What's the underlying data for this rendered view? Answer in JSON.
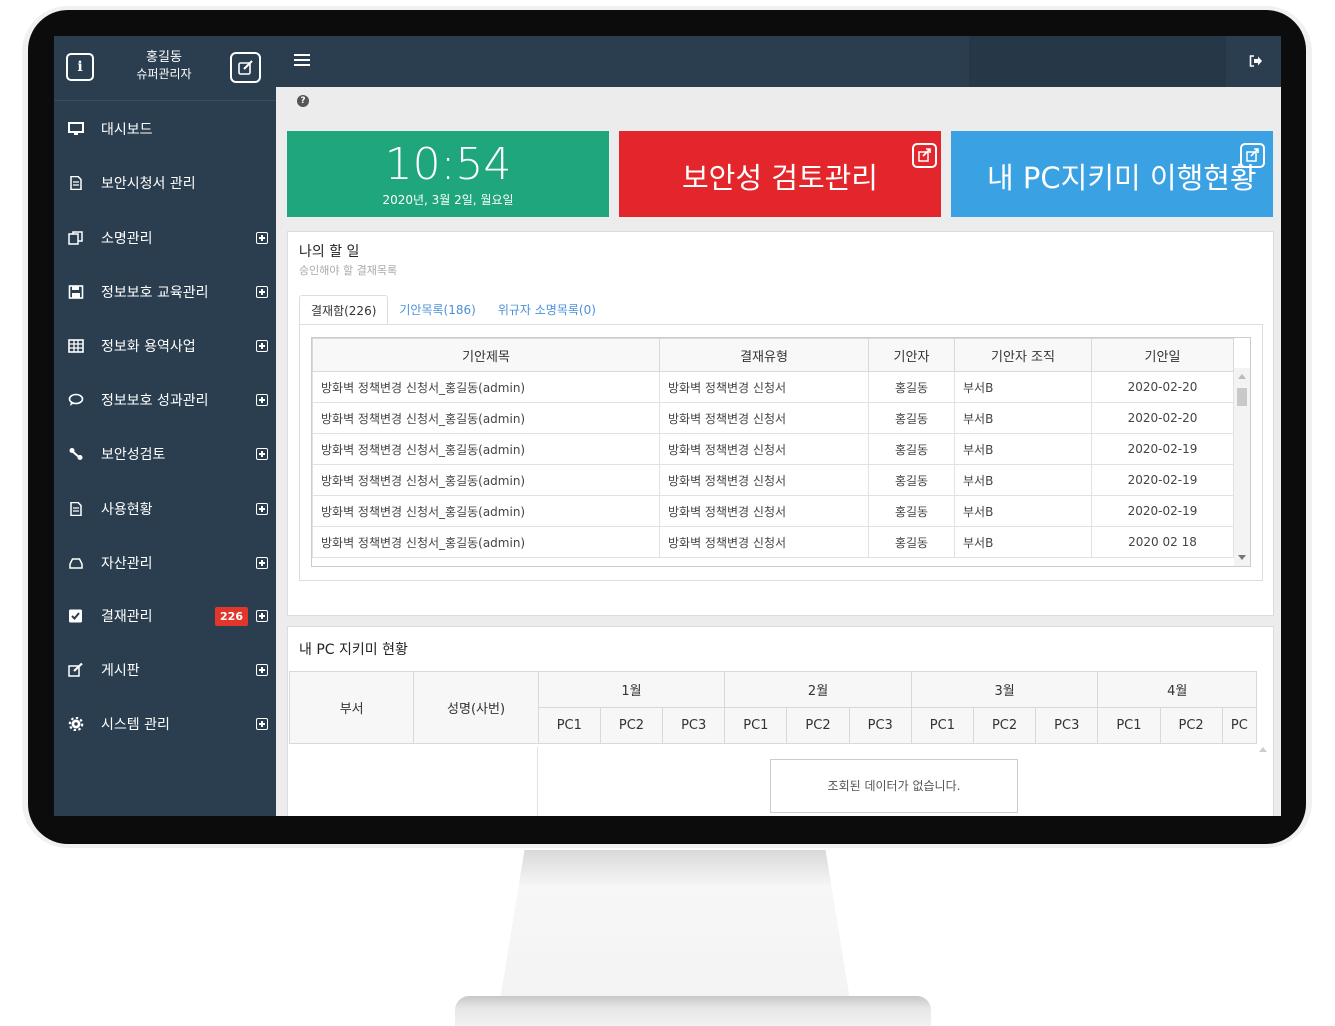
{
  "sidebar": {
    "user_name": "홍길동",
    "user_role": "슈퍼관리자",
    "items": [
      {
        "label": "대시보드",
        "icon": "monitor-icon",
        "expandable": false
      },
      {
        "label": "보안시청서 관리",
        "icon": "document-icon",
        "expandable": false
      },
      {
        "label": "소명관리",
        "icon": "copy-icon",
        "expandable": true
      },
      {
        "label": "정보보호 교육관리",
        "icon": "save-icon",
        "expandable": true
      },
      {
        "label": "정보화 용역사업",
        "icon": "table-icon",
        "expandable": true
      },
      {
        "label": "정보보호 성과관리",
        "icon": "comment-icon",
        "expandable": true
      },
      {
        "label": "보안성검토",
        "icon": "percent-icon",
        "expandable": true
      },
      {
        "label": "사용현황",
        "icon": "document-icon",
        "expandable": true
      },
      {
        "label": "자산관리",
        "icon": "hdd-icon",
        "expandable": true
      },
      {
        "label": "결재관리",
        "icon": "checkbox-icon",
        "expandable": true,
        "badge": "226"
      },
      {
        "label": "게시판",
        "icon": "edit-icon",
        "expandable": true
      },
      {
        "label": "시스템 관리",
        "icon": "gear-icon",
        "expandable": true
      }
    ]
  },
  "tiles": {
    "clock_time": "10:54",
    "clock_date": "2020년, 3월 2일, 월요일",
    "review_title": "보안성 검토관리",
    "pc_title": "내 PC지키미 이행현황"
  },
  "todo": {
    "title": "나의 할 일",
    "subtitle": "승인해야 할 결재목록",
    "tabs": [
      "결재함(226)",
      "기안목록(186)",
      "위규자 소명목록(0)"
    ],
    "columns": [
      "기안제목",
      "결재유형",
      "기안자",
      "기안자 조직",
      "기안일"
    ],
    "rows": [
      [
        "방화벽 정책변경 신청서_홍길동(admin)",
        "방화벽 정책변경 신청서",
        "홍길동",
        "부서B",
        "2020-02-20"
      ],
      [
        "방화벽 정책변경 신청서_홍길동(admin)",
        "방화벽 정책변경 신청서",
        "홍길동",
        "부서B",
        "2020-02-20"
      ],
      [
        "방화벽 정책변경 신청서_홍길동(admin)",
        "방화벽 정책변경 신청서",
        "홍길동",
        "부서B",
        "2020-02-19"
      ],
      [
        "방화벽 정책변경 신청서_홍길동(admin)",
        "방화벽 정책변경 신청서",
        "홍길동",
        "부서B",
        "2020-02-19"
      ],
      [
        "방화벽 정책변경 신청서_홍길동(admin)",
        "방화벽 정책변경 신청서",
        "홍길동",
        "부서B",
        "2020-02-19"
      ],
      [
        "방화벽 정책변경 신청서_홍길동(admin)",
        "방화벽 정책변경 신청서",
        "홍길동",
        "부서B",
        "2020 02 18"
      ]
    ]
  },
  "pc_status": {
    "title": "내 PC 지키미 현황",
    "col_dept": "부서",
    "col_name": "성명(사번)",
    "months": [
      "1월",
      "2월",
      "3월",
      "4월"
    ],
    "pcs": [
      "PC1",
      "PC2",
      "PC3"
    ],
    "pc_partial": "PC",
    "empty_message": "조회된 데이터가 없습니다."
  },
  "colors": {
    "sidebar": "#2b3e4f",
    "clock_tile": "#1fa67c",
    "review_tile": "#e3262b",
    "pc_tile": "#3aa1e3",
    "badge": "#e0362c"
  }
}
